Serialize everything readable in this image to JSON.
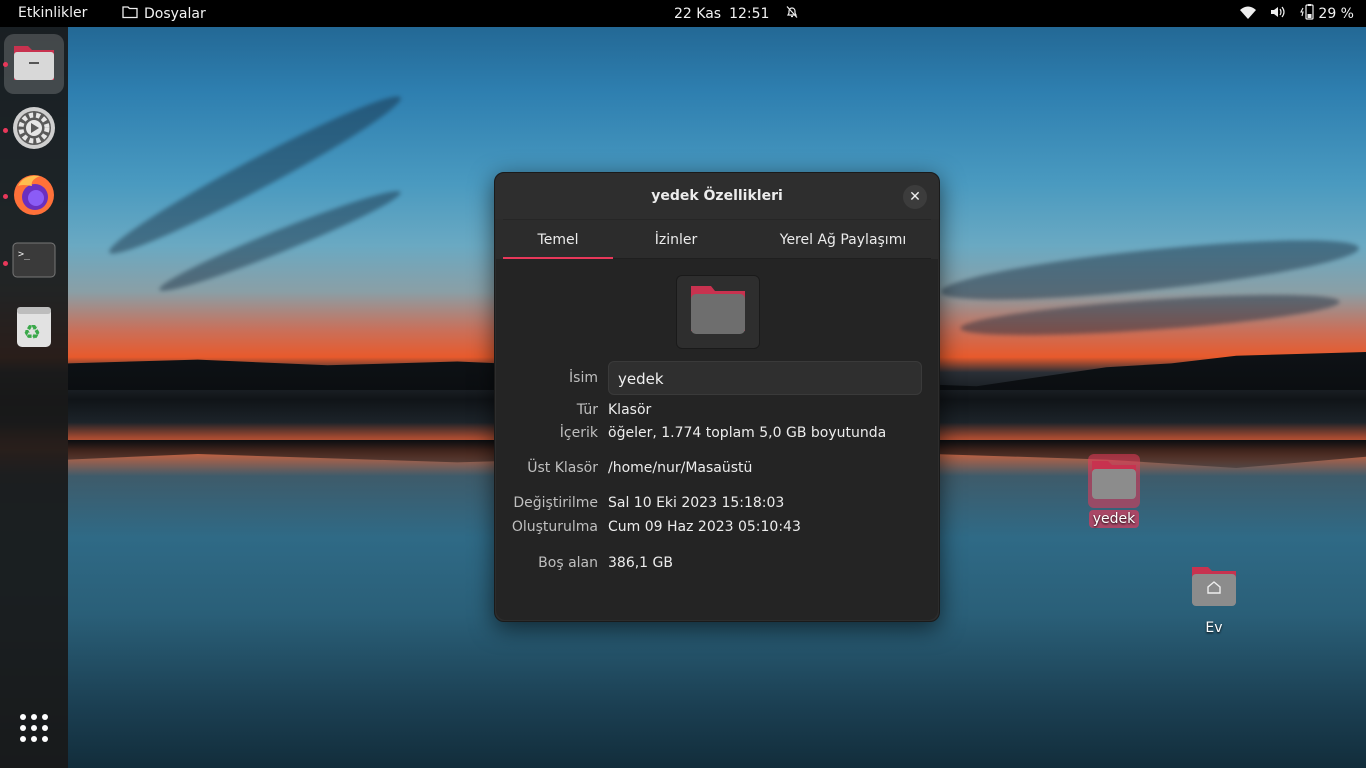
{
  "topbar": {
    "activities": "Etkinlikler",
    "app_name": "Dosyalar",
    "date": "22 Kas",
    "time": "12:51",
    "battery": "29 %"
  },
  "dock": {
    "items": [
      {
        "name": "files",
        "active": true
      },
      {
        "name": "settings",
        "active": false
      },
      {
        "name": "firefox",
        "active": false
      },
      {
        "name": "terminal",
        "active": false
      },
      {
        "name": "trash",
        "active": false
      }
    ]
  },
  "dialog": {
    "title": "yedek Özellikleri",
    "tabs": [
      {
        "label": "Temel",
        "active": true
      },
      {
        "label": "İzinler",
        "active": false
      },
      {
        "label": "Yerel Ağ Paylaşımı",
        "active": false
      }
    ],
    "name_label": "İsim",
    "name_value": "yedek",
    "type_label": "Tür",
    "type_value": "Klasör",
    "contents_label": "İçerik",
    "contents_value": "öğeler, 1.774 toplam 5,0 GB boyutunda",
    "parent_label": "Üst Klasör",
    "parent_value": "/home/nur/Masaüstü",
    "modified_label": "Değiştirilme",
    "modified_value": "Sal 10 Eki 2023 15:18:03",
    "created_label": "Oluşturulma",
    "created_value": "Cum 09 Haz 2023 05:10:43",
    "free_label": "Boş alan",
    "free_value": "386,1 GB"
  },
  "desktop": {
    "icons": [
      {
        "label": "yedek",
        "selected": true
      },
      {
        "label": "Ev",
        "selected": false
      }
    ]
  },
  "colors": {
    "accent": "#e8385a",
    "dialog_bg": "#2c2c2c",
    "folder_red": "#c8324f",
    "folder_grey": "#6e6e6e"
  }
}
